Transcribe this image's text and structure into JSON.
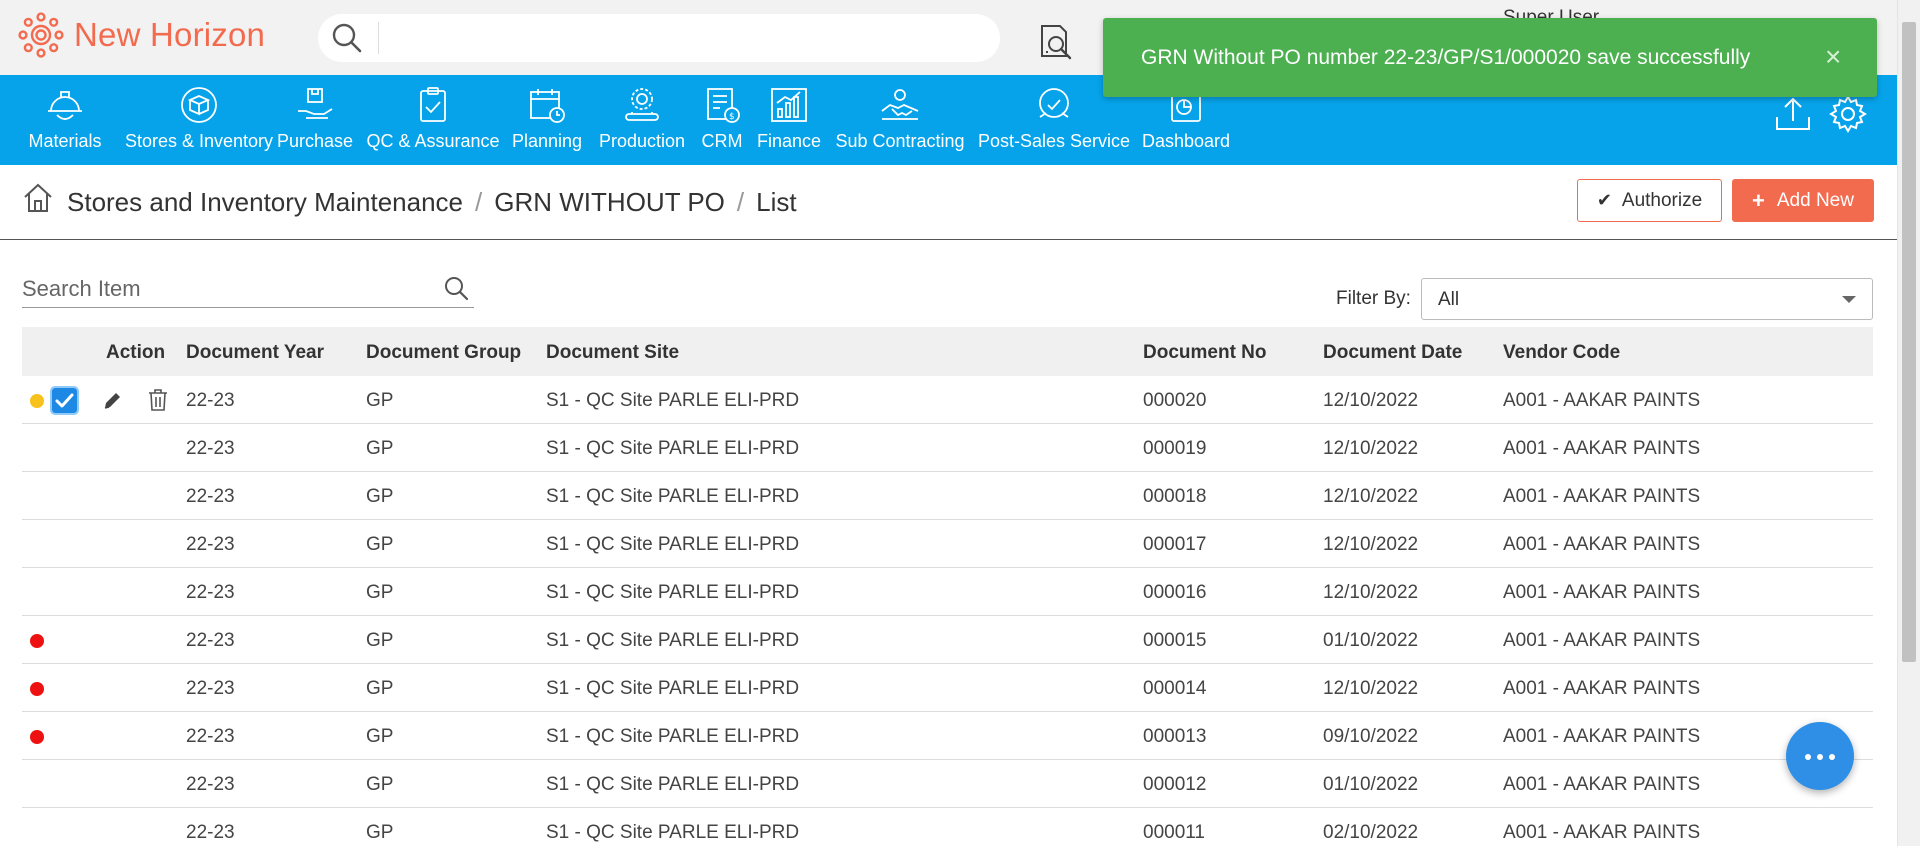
{
  "app": {
    "name": "New Horizon",
    "user": "Super User"
  },
  "search": {
    "placeholder": ""
  },
  "nav": [
    {
      "label": "Materials",
      "icon": "helmet-icon"
    },
    {
      "label": "Stores & Inventory",
      "icon": "box-icon"
    },
    {
      "label": "Purchase",
      "icon": "purchase-hand-icon"
    },
    {
      "label": "QC & Assurance",
      "icon": "clipboard-check-icon"
    },
    {
      "label": "Planning",
      "icon": "calendar-clock-icon"
    },
    {
      "label": "Production",
      "icon": "gear-conveyor-icon"
    },
    {
      "label": "CRM",
      "icon": "crm-doc-icon"
    },
    {
      "label": "Finance",
      "icon": "bar-chart-icon"
    },
    {
      "label": "Sub Contracting",
      "icon": "handshake-icon"
    },
    {
      "label": "Post-Sales Service",
      "icon": "service-support-icon"
    },
    {
      "label": "Dashboard",
      "icon": "dashboard-icon"
    }
  ],
  "toast": {
    "message": "GRN Without PO number 22-23/GP/S1/000020 save successfully",
    "close": "×"
  },
  "breadcrumb": {
    "module": "Stores and Inventory Maintenance",
    "page": "GRN WITHOUT PO",
    "view": "List"
  },
  "buttons": {
    "authorize": "Authorize",
    "add_new": "Add New"
  },
  "item_search": {
    "placeholder": "Search Item"
  },
  "filter": {
    "label": "Filter By:",
    "value": "All"
  },
  "table": {
    "headers": {
      "action": "Action",
      "year": "Document Year",
      "group": "Document Group",
      "site": "Document Site",
      "no": "Document No",
      "date": "Document Date",
      "vendor": "Vendor Code"
    },
    "rows": [
      {
        "status": "yellow",
        "selected": true,
        "actions": true,
        "year": "22-23",
        "group": "GP",
        "site": "S1 - QC Site PARLE ELI-PRD",
        "no": "000020",
        "date": "12/10/2022",
        "vendor": "A001 - AAKAR PAINTS"
      },
      {
        "status": "",
        "selected": false,
        "actions": false,
        "year": "22-23",
        "group": "GP",
        "site": "S1 - QC Site PARLE ELI-PRD",
        "no": "000019",
        "date": "12/10/2022",
        "vendor": "A001 - AAKAR PAINTS"
      },
      {
        "status": "",
        "selected": false,
        "actions": false,
        "year": "22-23",
        "group": "GP",
        "site": "S1 - QC Site PARLE ELI-PRD",
        "no": "000018",
        "date": "12/10/2022",
        "vendor": "A001 - AAKAR PAINTS"
      },
      {
        "status": "",
        "selected": false,
        "actions": false,
        "year": "22-23",
        "group": "GP",
        "site": "S1 - QC Site PARLE ELI-PRD",
        "no": "000017",
        "date": "12/10/2022",
        "vendor": "A001 - AAKAR PAINTS"
      },
      {
        "status": "",
        "selected": false,
        "actions": false,
        "year": "22-23",
        "group": "GP",
        "site": "S1 - QC Site PARLE ELI-PRD",
        "no": "000016",
        "date": "12/10/2022",
        "vendor": "A001 - AAKAR PAINTS"
      },
      {
        "status": "red",
        "selected": false,
        "actions": false,
        "year": "22-23",
        "group": "GP",
        "site": "S1 - QC Site PARLE ELI-PRD",
        "no": "000015",
        "date": "01/10/2022",
        "vendor": "A001 - AAKAR PAINTS"
      },
      {
        "status": "red",
        "selected": false,
        "actions": false,
        "year": "22-23",
        "group": "GP",
        "site": "S1 - QC Site PARLE ELI-PRD",
        "no": "000014",
        "date": "12/10/2022",
        "vendor": "A001 - AAKAR PAINTS"
      },
      {
        "status": "red",
        "selected": false,
        "actions": false,
        "year": "22-23",
        "group": "GP",
        "site": "S1 - QC Site PARLE ELI-PRD",
        "no": "000013",
        "date": "09/10/2022",
        "vendor": "A001 - AAKAR PAINTS"
      },
      {
        "status": "",
        "selected": false,
        "actions": false,
        "year": "22-23",
        "group": "GP",
        "site": "S1 - QC Site PARLE ELI-PRD",
        "no": "000012",
        "date": "01/10/2022",
        "vendor": "A001 - AAKAR PAINTS"
      },
      {
        "status": "",
        "selected": false,
        "actions": false,
        "year": "22-23",
        "group": "GP",
        "site": "S1 - QC Site PARLE ELI-PRD",
        "no": "000011",
        "date": "02/10/2022",
        "vendor": "A001 - AAKAR PAINTS"
      }
    ]
  },
  "colors": {
    "brand": "#f36b4f",
    "nav": "#06a3ea",
    "toast": "#4caf50",
    "checkbox": "#1e88e5",
    "status_yellow": "#f7c21b",
    "status_red": "#ee1111"
  }
}
